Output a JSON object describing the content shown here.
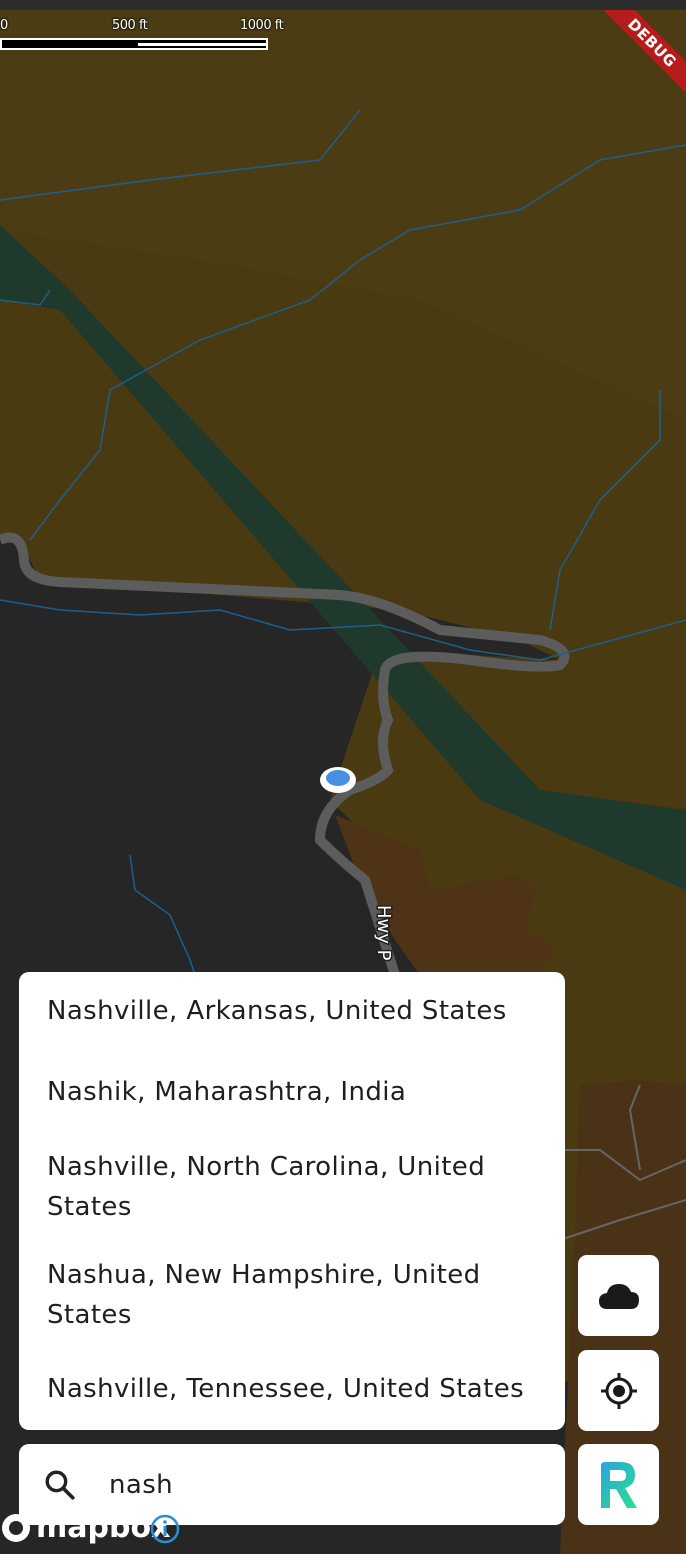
{
  "scale": {
    "label_0": "0",
    "label_500": "500 ft",
    "label_1000": "1000 ft"
  },
  "debug_banner": "DEBUG",
  "road_label": "Hwy P",
  "suggestions": [
    {
      "text": "Nashville, Arkansas, United States"
    },
    {
      "text": "Nashik, Maharashtra, India"
    },
    {
      "text": "Nashville, North Carolina, United States"
    },
    {
      "text": "Nashua, New Hampshire, United States"
    },
    {
      "text": "Nashville, Tennessee, United States"
    }
  ],
  "search": {
    "value": "nash",
    "icon": "search-icon"
  },
  "buttons": {
    "weather": {
      "icon": "cloud-icon"
    },
    "locate": {
      "icon": "gps-locate-icon"
    },
    "app": {
      "icon": "app-logo-icon"
    }
  },
  "attribution": {
    "logo_text": "mapbox",
    "info_icon": "info-icon"
  },
  "colors": {
    "terrain": "#4a3a12",
    "water_band": "#1c3a2e",
    "dark_area": "#262626",
    "road": "#5a5a5a",
    "stream": "#1f5f8c",
    "location_dot": "#4a90e2",
    "debug": "#b71c1c"
  }
}
